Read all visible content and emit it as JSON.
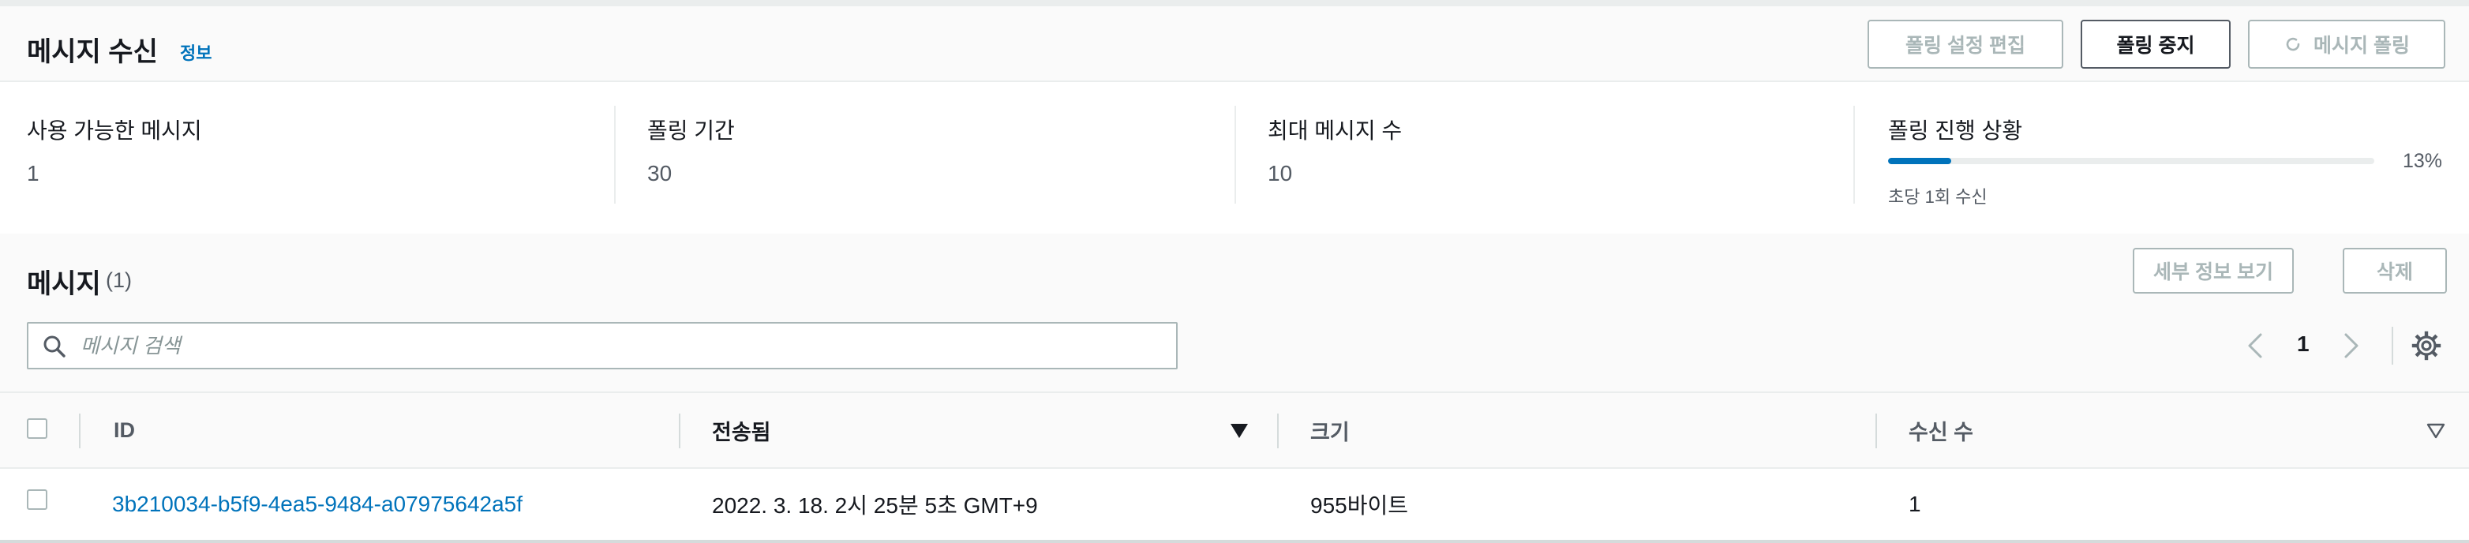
{
  "receive": {
    "title": "메시지 수신",
    "info_link": "정보",
    "buttons": {
      "edit_polling": "폴링 설정 편집",
      "stop_polling": "폴링 중지",
      "poll_messages": "메시지 폴링"
    },
    "stats": [
      {
        "label": "사용 가능한 메시지",
        "value": "1"
      },
      {
        "label": "폴링 기간",
        "value": "30"
      },
      {
        "label": "최대 메시지 수",
        "value": "10"
      }
    ],
    "progress": {
      "label": "폴링 진행 상황",
      "percent_text": "13%",
      "percent": 13,
      "description": "초당 1회 수신"
    }
  },
  "messages": {
    "title": "메시지",
    "count": "(1)",
    "buttons": {
      "details": "세부 정보 보기",
      "delete": "삭제"
    },
    "search_placeholder": "메시지 검색",
    "page": "1",
    "columns": [
      "ID",
      "전송됨",
      "크기",
      "수신 수"
    ],
    "rows": [
      {
        "id": "3b210034-b5f9-4ea5-9484-a07975642a5f",
        "sent": "2022. 3. 18. 2시 25분 5초 GMT+9",
        "size": "955바이트",
        "receive_count": "1"
      }
    ]
  },
  "icons": [
    "refresh-icon",
    "search-icon",
    "chevron-left-icon",
    "chevron-right-icon",
    "settings-icon",
    "sort-descending-icon",
    "sort-caret-icon",
    "checkbox"
  ],
  "colors": {
    "link": "#0073bb",
    "progress": "#0073bb",
    "text": "#16191f",
    "muted": "#545b64",
    "disabled": "#aab7b8"
  }
}
